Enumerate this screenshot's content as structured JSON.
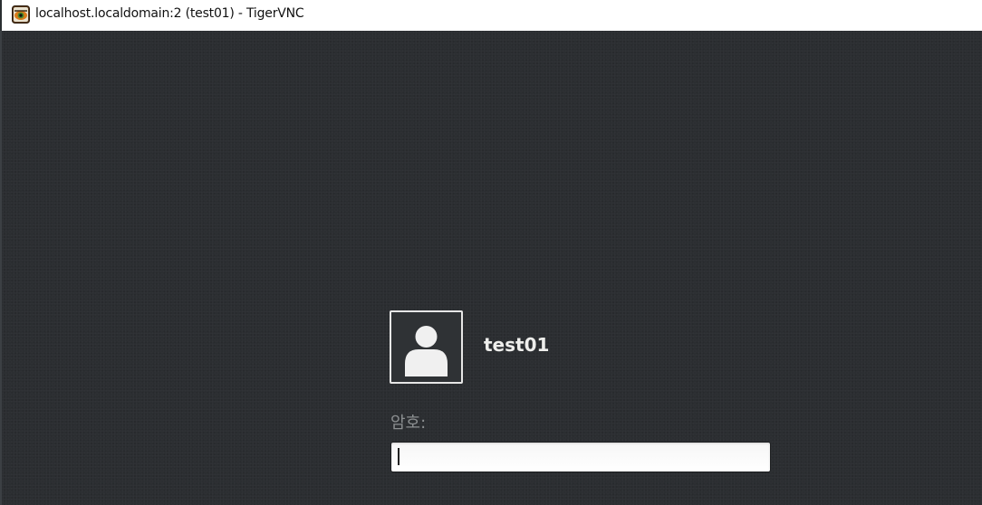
{
  "window": {
    "title": "localhost.localdomain:2 (test01) - TigerVNC",
    "app_icon": "tigervnc-icon"
  },
  "login": {
    "avatar_icon": "user-avatar-icon",
    "username": "test01",
    "password_label": "암호:",
    "password_value": "",
    "password_placeholder": ""
  },
  "colors": {
    "desktop_background": "#2b2e31",
    "username_text": "#eeeeec",
    "label_text": "#8c8f91",
    "input_background": "#ffffff"
  }
}
